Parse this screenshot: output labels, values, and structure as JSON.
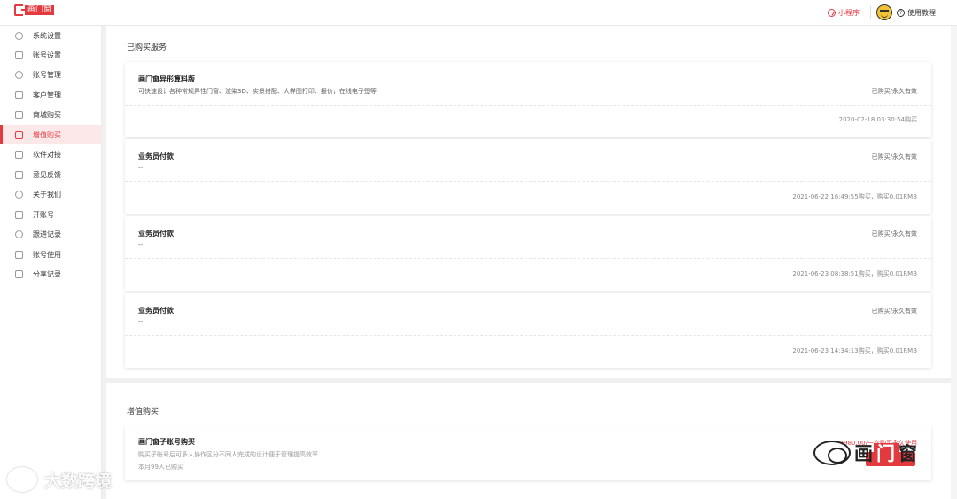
{
  "header": {
    "logo_text": "画门窗",
    "mini_program": "小程序",
    "help": "使用教程"
  },
  "sidebar": {
    "items": [
      {
        "label": "系统设置",
        "icon": "gear-icon"
      },
      {
        "label": "账号设置",
        "icon": "account-card-icon"
      },
      {
        "label": "账号管理",
        "icon": "user-icon"
      },
      {
        "label": "客户管理",
        "icon": "customer-icon"
      },
      {
        "label": "商城购买",
        "icon": "shop-icon"
      },
      {
        "label": "增值购买",
        "icon": "box-icon"
      },
      {
        "label": "软件对接",
        "icon": "connect-icon"
      },
      {
        "label": "意见反馈",
        "icon": "inbox-icon"
      },
      {
        "label": "关于我们",
        "icon": "info-icon"
      },
      {
        "label": "开账号",
        "icon": "open-account-icon"
      },
      {
        "label": "跟进记录",
        "icon": "target-icon"
      },
      {
        "label": "账号使用",
        "icon": "usage-icon"
      },
      {
        "label": "分享记录",
        "icon": "share-record-icon"
      }
    ],
    "active_index": 5
  },
  "purchased": {
    "title": "已购买服务",
    "items": [
      {
        "name": "画门窗异形算料版",
        "desc": "可快速设计各种常规异性门窗、渲染3D、实景搭配、大样图打印、报价，在线电子签等",
        "status": "已购买/永久有效",
        "time": "2020-02-18 03:30:54购买"
      },
      {
        "name": "业务员付款",
        "desc": "--",
        "status": "已购买/永久有效",
        "time": "2021-06-22 16:49:55购买，购买0.01RMB"
      },
      {
        "name": "业务员付款",
        "desc": "--",
        "status": "已购买/永久有效",
        "time": "2021-06-23 08:38:51购买，购买0.01RMB"
      },
      {
        "name": "业务员付款",
        "desc": "--",
        "status": "已购买/永久有效",
        "time": "2021-06-23 14:34:13购买，购买0.01RMB"
      }
    ]
  },
  "value_added": {
    "title": "增值购买",
    "item": {
      "name": "画门窗子账号购买",
      "desc": "购买子账号后可多人协作区分不同人完成的设计便于管理提高效率",
      "sold": "本月99人已购买",
      "price": "¥980.00/一次购买永久使用",
      "button": "购买"
    }
  },
  "watermarks": {
    "left": "大数跨境",
    "right_a": "画",
    "right_b": "门",
    "right_c": "窗"
  },
  "colors": {
    "accent": "#e33a40"
  }
}
